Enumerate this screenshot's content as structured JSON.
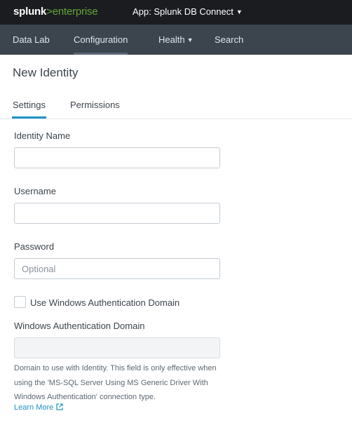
{
  "header": {
    "logo": {
      "brand": "splunk",
      "separator": ">",
      "product": "enterprise"
    },
    "app_menu": {
      "label": "App: Splunk DB Connect",
      "icon": "caret-down-icon"
    }
  },
  "nav": {
    "items": [
      {
        "label": "Data Lab"
      },
      {
        "label": "Configuration",
        "active": true
      },
      {
        "label": "Health",
        "icon": "caret-down-icon"
      },
      {
        "label": "Search"
      }
    ]
  },
  "page": {
    "title": "New Identity"
  },
  "tabs": [
    {
      "label": "Settings",
      "active": true
    },
    {
      "label": "Permissions"
    }
  ],
  "form": {
    "identity_name": {
      "label": "Identity Name",
      "value": "",
      "placeholder": ""
    },
    "username": {
      "label": "Username",
      "value": "",
      "placeholder": ""
    },
    "password": {
      "label": "Password",
      "value": "",
      "placeholder": "Optional"
    },
    "use_windows_auth": {
      "label": "Use Windows Authentication Domain",
      "checked": false
    },
    "windows_domain": {
      "label": "Windows Authentication Domain",
      "value": "",
      "disabled": true,
      "help": "Domain to use with Identity. This field is only effective when using the 'MS-SQL Server Using MS Generic Driver With Windows Authentication' connection type.",
      "learn_more": "Learn More",
      "learn_more_icon": "external-link-icon"
    }
  },
  "colors": {
    "topbar": "#1a1c20",
    "navbar": "#3c444d",
    "brand_green": "#65a637",
    "accent_blue": "#1e93c6"
  }
}
